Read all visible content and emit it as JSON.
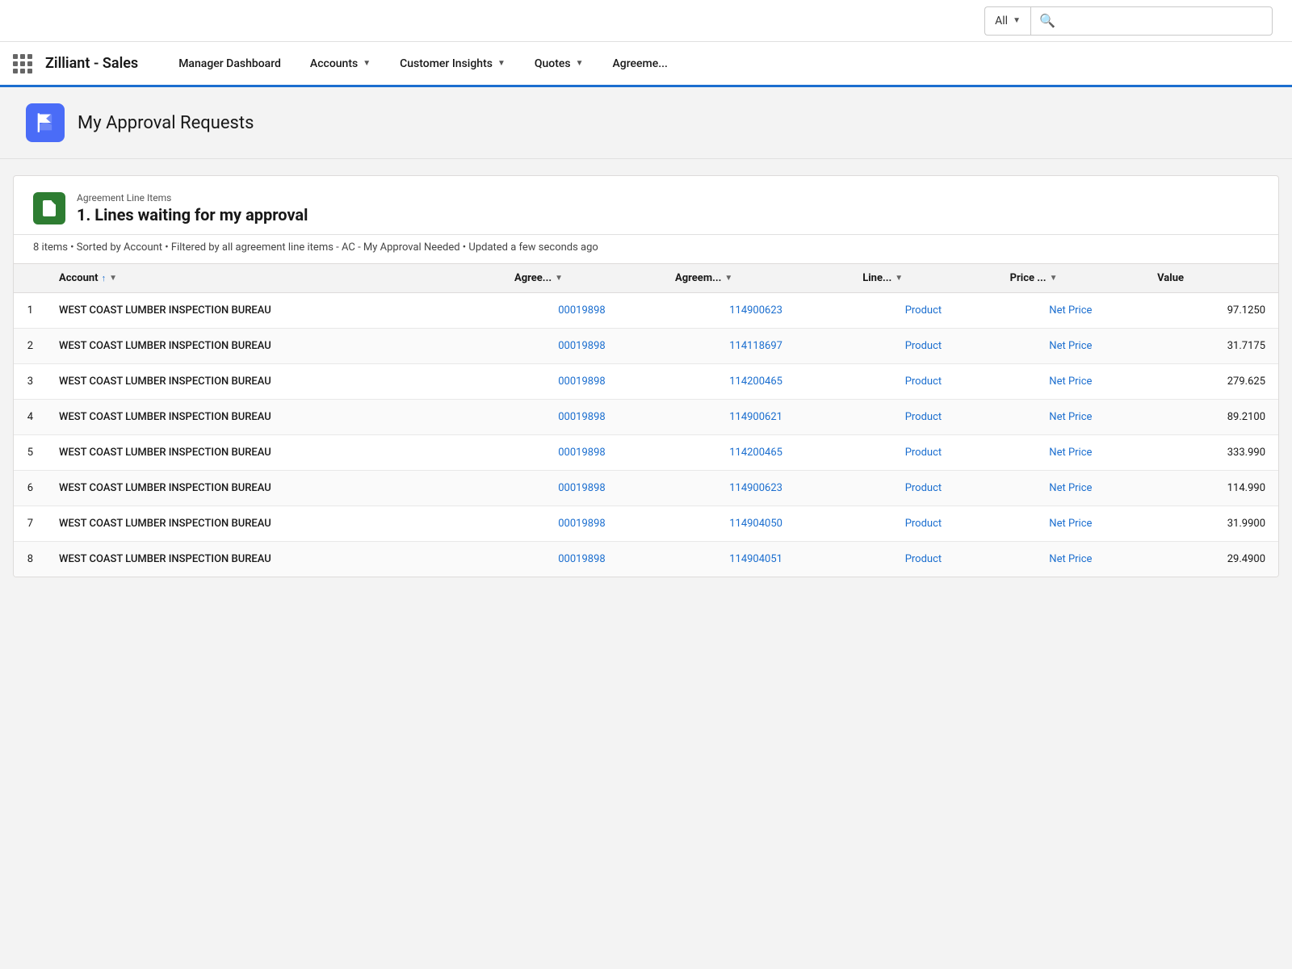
{
  "topbar": {
    "search_dropdown_label": "All",
    "search_placeholder": ""
  },
  "navbar": {
    "brand": "Zilliant - Sales",
    "items": [
      {
        "label": "Manager Dashboard",
        "has_caret": false
      },
      {
        "label": "Accounts",
        "has_caret": true
      },
      {
        "label": "Customer Insights",
        "has_caret": true
      },
      {
        "label": "Quotes",
        "has_caret": true
      },
      {
        "label": "Agreeme...",
        "has_caret": false
      }
    ]
  },
  "page": {
    "title": "My Approval Requests"
  },
  "section": {
    "subtitle": "Agreement Line Items",
    "title": "1. Lines waiting for my approval",
    "meta": "8 items • Sorted by Account • Filtered by all agreement line items - AC - My Approval Needed • Updated a few seconds ago"
  },
  "table": {
    "columns": [
      {
        "label": "",
        "key": "num"
      },
      {
        "label": "Account",
        "key": "account",
        "sort": "asc"
      },
      {
        "label": "Agree...",
        "key": "agree",
        "has_caret": true
      },
      {
        "label": "Agreem...",
        "key": "agreem",
        "has_caret": true
      },
      {
        "label": "Line...",
        "key": "line",
        "has_caret": true
      },
      {
        "label": "Price ...",
        "key": "price",
        "has_caret": true
      },
      {
        "label": "Value",
        "key": "value"
      }
    ],
    "rows": [
      {
        "num": 1,
        "account": "WEST COAST LUMBER INSPECTION BUREAU",
        "agree": "00019898",
        "agreem": "114900623",
        "line": "Product",
        "price": "Net Price",
        "value": "97.1250"
      },
      {
        "num": 2,
        "account": "WEST COAST LUMBER INSPECTION BUREAU",
        "agree": "00019898",
        "agreem": "114118697",
        "line": "Product",
        "price": "Net Price",
        "value": "31.7175"
      },
      {
        "num": 3,
        "account": "WEST COAST LUMBER INSPECTION BUREAU",
        "agree": "00019898",
        "agreem": "114200465",
        "line": "Product",
        "price": "Net Price",
        "value": "279.625"
      },
      {
        "num": 4,
        "account": "WEST COAST LUMBER INSPECTION BUREAU",
        "agree": "00019898",
        "agreem": "114900621",
        "line": "Product",
        "price": "Net Price",
        "value": "89.2100"
      },
      {
        "num": 5,
        "account": "WEST COAST LUMBER INSPECTION BUREAU",
        "agree": "00019898",
        "agreem": "114200465",
        "line": "Product",
        "price": "Net Price",
        "value": "333.990"
      },
      {
        "num": 6,
        "account": "WEST COAST LUMBER INSPECTION BUREAU",
        "agree": "00019898",
        "agreem": "114900623",
        "line": "Product",
        "price": "Net Price",
        "value": "114.990"
      },
      {
        "num": 7,
        "account": "WEST COAST LUMBER INSPECTION BUREAU",
        "agree": "00019898",
        "agreem": "114904050",
        "line": "Product",
        "price": "Net Price",
        "value": "31.9900"
      },
      {
        "num": 8,
        "account": "WEST COAST LUMBER INSPECTION BUREAU",
        "agree": "00019898",
        "agreem": "114904051",
        "line": "Product",
        "price": "Net Price",
        "value": "29.4900"
      }
    ]
  }
}
